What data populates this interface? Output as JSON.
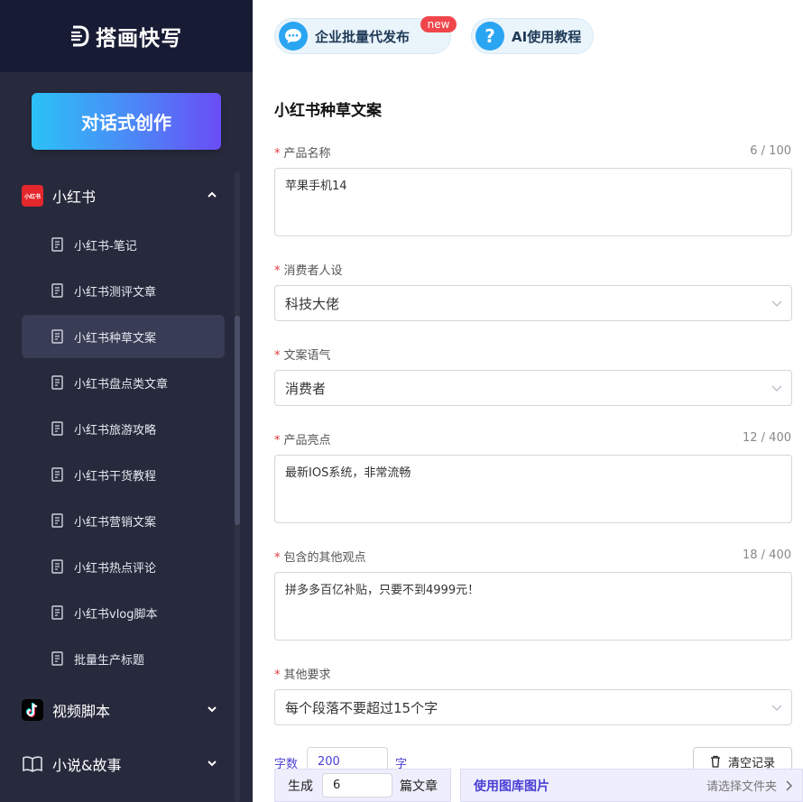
{
  "app": {
    "logo_text": "搭画快写"
  },
  "sidebar": {
    "chat_button": "对话式创作",
    "sections": [
      {
        "label": "小红书",
        "badge_text": "小红书",
        "expanded": true
      },
      {
        "label": "视频脚本",
        "expanded": false
      },
      {
        "label": "小说&故事",
        "expanded": false
      }
    ],
    "items": [
      {
        "label": "小红书-笔记"
      },
      {
        "label": "小红书测评文章"
      },
      {
        "label": "小红书种草文案",
        "active": true
      },
      {
        "label": "小红书盘点类文章"
      },
      {
        "label": "小红书旅游攻略"
      },
      {
        "label": "小红书干货教程"
      },
      {
        "label": "小红书营销文案"
      },
      {
        "label": "小红书热点评论"
      },
      {
        "label": "小红书vlog脚本"
      },
      {
        "label": "批量生产标题"
      }
    ]
  },
  "topbar": {
    "batch_label": "企业批量代发布",
    "new_badge": "new",
    "tutorial_label": "AI使用教程",
    "tutorial_icon_text": "?"
  },
  "form": {
    "title": "小红书种草文案",
    "required_mark": "*",
    "product_name": {
      "label": "产品名称",
      "value": "苹果手机14",
      "counter": "6 / 100"
    },
    "persona": {
      "label": "消费者人设",
      "value": "科技大佬"
    },
    "tone": {
      "label": "文案语气",
      "value": "消费者"
    },
    "highlights": {
      "label": "产品亮点",
      "value": "最新IOS系统，非常流畅",
      "counter": "12 / 400"
    },
    "other_views": {
      "label": "包含的其他观点",
      "value": "拼多多百亿补贴，只要不到4999元！",
      "counter": "18 / 400"
    },
    "other_req": {
      "label": "其他要求",
      "value": "每个段落不要超过15个字"
    },
    "word_count": {
      "label": "字数",
      "value": "200",
      "unit": "字"
    },
    "clear_button": "清空记录",
    "generate": {
      "prefix": "生成",
      "value": "6",
      "suffix": "篇文章"
    },
    "library": {
      "label": "使用图库图片",
      "folder_hint": "请选择文件夹"
    }
  },
  "colors": {
    "sidebar_bg": "#272a3c",
    "logo_bar_bg": "#181b34",
    "accent": "#4a3fd6",
    "required": "#e0383e"
  }
}
